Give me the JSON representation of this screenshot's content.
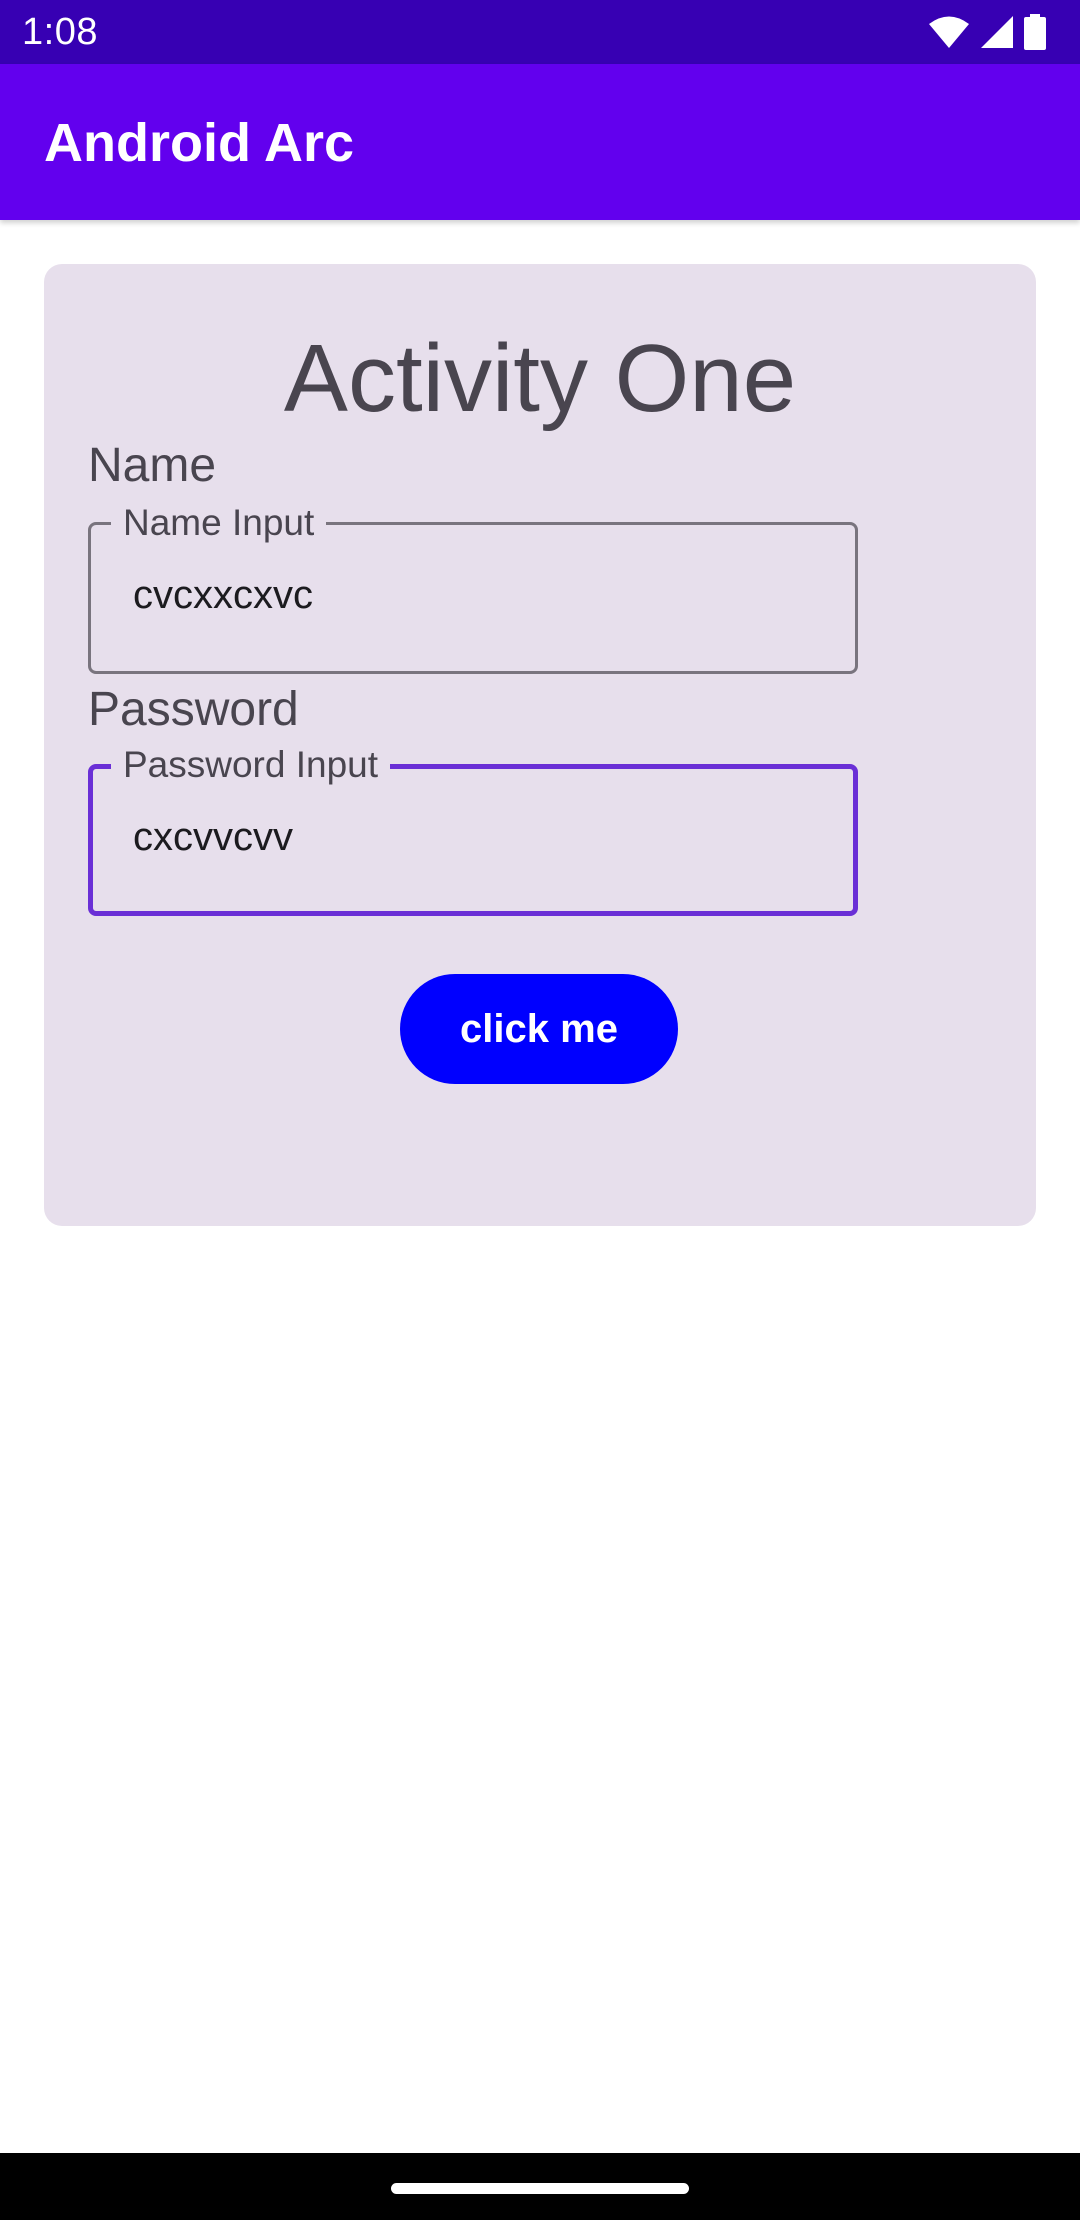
{
  "status_bar": {
    "time": "1:08",
    "icons": [
      "wifi-icon",
      "cellular-signal-icon",
      "battery-icon"
    ]
  },
  "app_bar": {
    "title": "Android Arc"
  },
  "card": {
    "title": "Activity One",
    "name": {
      "label": "Name",
      "floating_label": "Name Input",
      "value": "cvcxxcxvc"
    },
    "password": {
      "label": "Password",
      "floating_label": "Password Input",
      "value": "cxcvvcvv",
      "focused": true
    },
    "button_label": "click me"
  },
  "colors": {
    "status_bar": "#3700b3",
    "app_bar": "#6200ee",
    "card_background": "#e7dfec",
    "button": "#0000ff",
    "focused_outline": "#6a2fd6"
  }
}
